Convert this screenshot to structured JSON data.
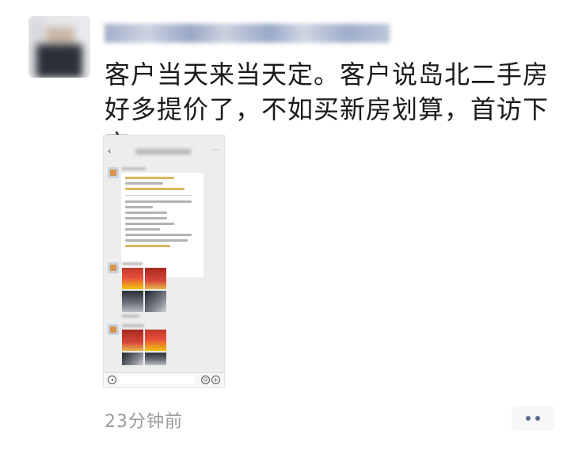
{
  "post": {
    "text": "客户当天来当天定。客户说岛北二手房好多提价了，不如买新房划算，首访下定",
    "time": "23分钟前"
  },
  "icons": {
    "more_actions": "more-dots-icon",
    "voice": "voice-icon",
    "emoji": "emoji-icon",
    "plus": "plus-icon",
    "back": "back-chevron-icon"
  },
  "colors": {
    "more_dots": "#5b6a91",
    "timestamp": "#9b9b9b",
    "text": "#1a1a1a"
  }
}
